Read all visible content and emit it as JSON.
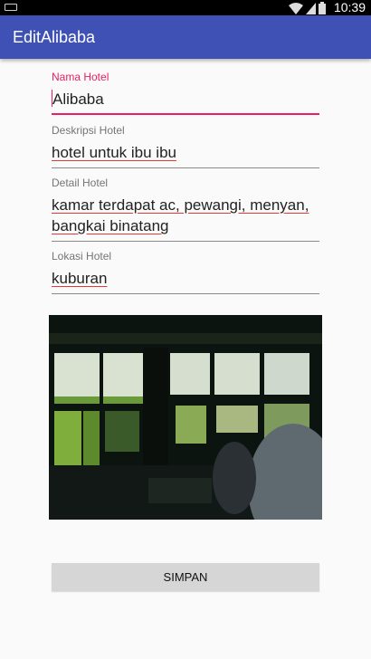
{
  "status_bar": {
    "time": "10:39"
  },
  "app_bar": {
    "title": "EditAlibaba"
  },
  "form": {
    "nama_hotel": {
      "label": "Nama Hotel",
      "value": "Alibaba"
    },
    "deskripsi_hotel": {
      "label": "Deskripsi Hotel",
      "value": "hotel untuk ibu ibu"
    },
    "detail_hotel": {
      "label": "Detail Hotel",
      "value": "kamar terdapat ac, pewangi, menyan, bangkai binatang"
    },
    "lokasi_hotel": {
      "label": "Lokasi Hotel",
      "value": "kuburan"
    }
  },
  "save_button": {
    "label": "SIMPAN"
  },
  "colors": {
    "primary": "#3f51b5",
    "accent": "#e91e63"
  }
}
